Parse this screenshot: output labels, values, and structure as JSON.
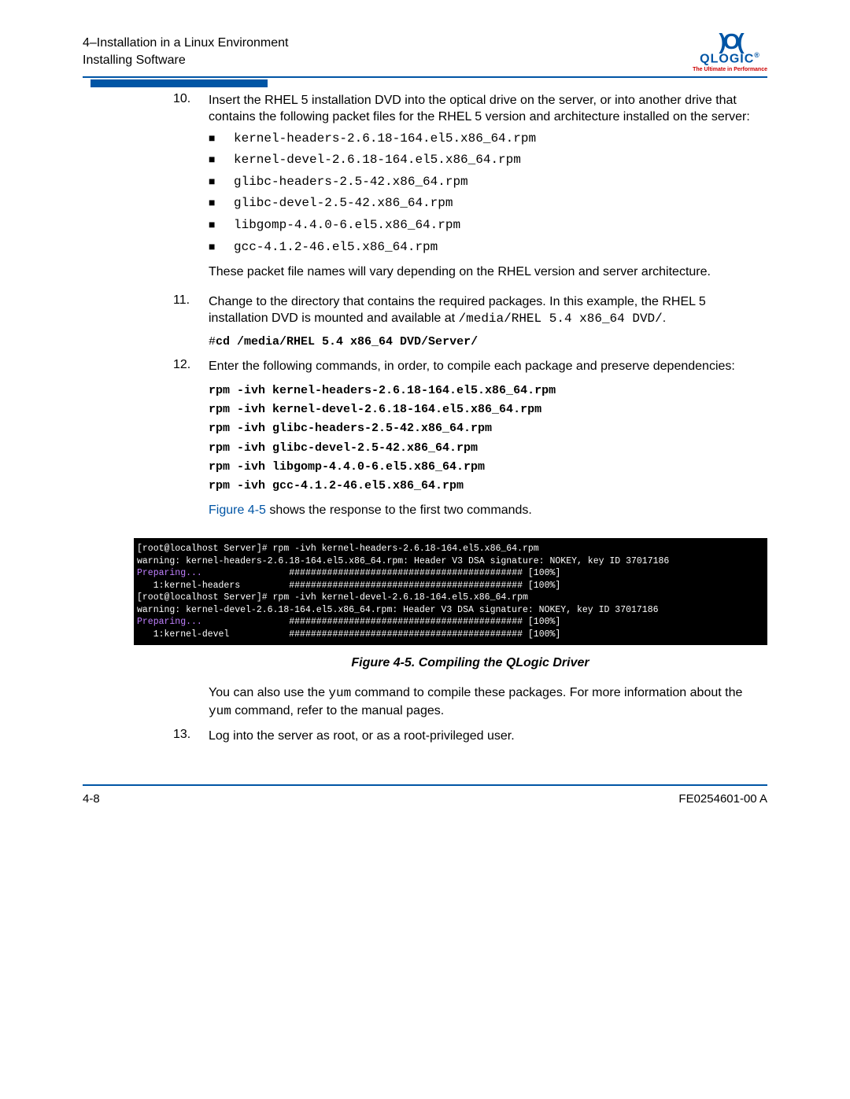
{
  "header": {
    "chapter_line": "4–Installation in a Linux Environment",
    "section_line": "Installing Software",
    "logo_text": "QLOGIC",
    "logo_tagline": "The Ultimate in Performance"
  },
  "step10": {
    "num": "10.",
    "intro": "Insert the RHEL 5 installation DVD into the optical drive on the server, or into another drive that contains the following packet files for the RHEL 5 version and architecture installed on the server:",
    "bullets": [
      "kernel-headers-2.6.18-164.el5.x86_64.rpm",
      "kernel-devel-2.6.18-164.el5.x86_64.rpm",
      "glibc-headers-2.5-42.x86_64.rpm",
      "glibc-devel-2.5-42.x86_64.rpm",
      "libgomp-4.4.0-6.el5.x86_64.rpm",
      "gcc-4.1.2-46.el5.x86_64.rpm"
    ],
    "outro": "These packet file names will vary depending on the RHEL version and server architecture."
  },
  "step11": {
    "num": "11.",
    "p1": "Change to the directory that contains the required packages. In this example, the RHEL 5 installation DVD is mounted and available at ",
    "path": "/media/RHEL 5.4 x86_64 DVD/",
    "period": ".",
    "cmd_prefix": "#",
    "cmd": "cd /media/RHEL 5.4 x86_64 DVD/Server/"
  },
  "step12": {
    "num": "12.",
    "intro": "Enter the following commands, in order, to compile each package and preserve dependencies:",
    "cmds": [
      "rpm -ivh kernel-headers-2.6.18-164.el5.x86_64.rpm",
      "rpm -ivh kernel-devel-2.6.18-164.el5.x86_64.rpm",
      "rpm -ivh glibc-headers-2.5-42.x86_64.rpm",
      "rpm -ivh glibc-devel-2.5-42.x86_64.rpm",
      "rpm -ivh libgomp-4.4.0-6.el5.x86_64.rpm",
      "rpm -ivh gcc-4.1.2-46.el5.x86_64.rpm"
    ],
    "figref": "Figure 4-5",
    "figref_after": " shows the response to the first two commands."
  },
  "terminal": {
    "l1": "[root@localhost Server]# rpm -ivh kernel-headers-2.6.18-164.el5.x86_64.rpm",
    "l2": "warning: kernel-headers-2.6.18-164.el5.x86_64.rpm: Header V3 DSA signature: NOKEY, key ID 37017186",
    "l3a": "Preparing...",
    "l3b": "                ########################################### [100%]",
    "l4a": "   1:kernel-headers",
    "l4b": "         ########################################### [100%]",
    "l5": "[root@localhost Server]# rpm -ivh kernel-devel-2.6.18-164.el5.x86_64.rpm",
    "l6": "warning: kernel-devel-2.6.18-164.el5.x86_64.rpm: Header V3 DSA signature: NOKEY, key ID 37017186",
    "l7a": "Preparing...",
    "l7b": "                ########################################### [100%]",
    "l8a": "   1:kernel-devel",
    "l8b": "           ########################################### [100%]"
  },
  "caption": "Figure 4-5. Compiling the QLogic Driver",
  "post": {
    "p1a": "You can also use the ",
    "yum1": "yum",
    "p1b": " command to compile these packages. For more information about the ",
    "yum2": "yum",
    "p1c": " command, refer to the manual pages."
  },
  "step13": {
    "num": "13.",
    "text": "Log into the server as root, or as a root-privileged user."
  },
  "footer": {
    "left": "4-8",
    "right": "FE0254601-00 A"
  }
}
